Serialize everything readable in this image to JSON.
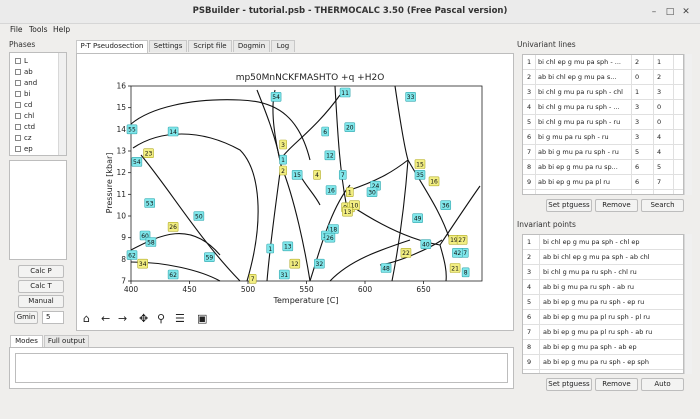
{
  "window": {
    "title": "PSBuilder - tutorial.psb - THERMOCALC 3.50 (Free Pascal version)",
    "minimize": "–",
    "maximize": "□",
    "close": "✕"
  },
  "menu": [
    "File",
    "Tools",
    "Help"
  ],
  "phases_panel": {
    "label": "Phases",
    "items": [
      "L",
      "ab",
      "and",
      "bi",
      "cd",
      "chl",
      "ctd",
      "cz",
      "ep"
    ]
  },
  "left_buttons": {
    "calc_p": "Calc P",
    "calc_t": "Calc T",
    "manual": "Manual",
    "gmin_label": "Gmin",
    "gmin_value": "5"
  },
  "tabs": [
    "P-T Pseudosection",
    "Settings",
    "Script file",
    "Dogmin",
    "Log"
  ],
  "chart_data": {
    "type": "scatter",
    "title": "mp50MnNCKFMASHTO +q +H2O",
    "xlabel": "Temperature [C]",
    "ylabel": "Pressure [kbar]",
    "xlim": [
      400,
      700
    ],
    "ylim": [
      7,
      16
    ],
    "xticks": [
      400,
      450,
      500,
      550,
      600,
      650
    ],
    "yticks": [
      7,
      8,
      9,
      10,
      11,
      12,
      13,
      14,
      15,
      16
    ],
    "univariant_labels": [
      {
        "text": "55",
        "x": 400,
        "y": 14.0
      },
      {
        "text": "54",
        "x": 405,
        "y": 12.5
      },
      {
        "text": "53",
        "x": 416,
        "y": 10.6
      },
      {
        "text": "60",
        "x": 412,
        "y": 9.1
      },
      {
        "text": "58",
        "x": 417,
        "y": 8.8
      },
      {
        "text": "62",
        "x": 400,
        "y": 8.2
      },
      {
        "text": "14",
        "x": 436,
        "y": 13.9
      },
      {
        "text": "50",
        "x": 458,
        "y": 10.0
      },
      {
        "text": "59",
        "x": 467,
        "y": 8.1
      },
      {
        "text": "62",
        "x": 436,
        "y": 7.3
      },
      {
        "text": "54",
        "x": 524,
        "y": 15.5
      },
      {
        "text": "11",
        "x": 583,
        "y": 15.7
      },
      {
        "text": "33",
        "x": 639,
        "y": 15.5
      },
      {
        "text": "20",
        "x": 587,
        "y": 14.1
      },
      {
        "text": "6",
        "x": 566,
        "y": 13.9
      },
      {
        "text": "12",
        "x": 570,
        "y": 12.8
      },
      {
        "text": "1",
        "x": 530,
        "y": 12.6
      },
      {
        "text": "15",
        "x": 542,
        "y": 11.9
      },
      {
        "text": "7",
        "x": 581,
        "y": 11.9
      },
      {
        "text": "16",
        "x": 571,
        "y": 11.2
      },
      {
        "text": "24",
        "x": 609,
        "y": 11.4
      },
      {
        "text": "30",
        "x": 606,
        "y": 11.1
      },
      {
        "text": "35",
        "x": 647,
        "y": 11.9
      },
      {
        "text": "49",
        "x": 645,
        "y": 9.9
      },
      {
        "text": "36",
        "x": 669,
        "y": 10.5
      },
      {
        "text": "13",
        "x": 534,
        "y": 8.6
      },
      {
        "text": "1",
        "x": 519,
        "y": 8.5
      },
      {
        "text": "18",
        "x": 573,
        "y": 9.4
      },
      {
        "text": "17",
        "x": 567,
        "y": 9.1
      },
      {
        "text": "26",
        "x": 570,
        "y": 9.0
      },
      {
        "text": "32",
        "x": 561,
        "y": 7.8
      },
      {
        "text": "31",
        "x": 531,
        "y": 7.3
      },
      {
        "text": "40",
        "x": 652,
        "y": 8.7
      },
      {
        "text": "47",
        "x": 684,
        "y": 8.3
      },
      {
        "text": "42",
        "x": 679,
        "y": 8.3
      },
      {
        "text": "48",
        "x": 618,
        "y": 7.6
      },
      {
        "text": "8",
        "x": 686,
        "y": 7.4
      }
    ],
    "invariant_labels": [
      {
        "text": "23",
        "x": 415,
        "y": 12.9
      },
      {
        "text": "26",
        "x": 436,
        "y": 9.5
      },
      {
        "text": "34",
        "x": 410,
        "y": 7.8
      },
      {
        "text": "3",
        "x": 530,
        "y": 13.3
      },
      {
        "text": "2",
        "x": 530,
        "y": 12.1
      },
      {
        "text": "4",
        "x": 559,
        "y": 11.9
      },
      {
        "text": "1",
        "x": 587,
        "y": 11.1
      },
      {
        "text": "9",
        "x": 583,
        "y": 10.4
      },
      {
        "text": "5",
        "x": 588,
        "y": 10.4
      },
      {
        "text": "10",
        "x": 591,
        "y": 10.5
      },
      {
        "text": "13",
        "x": 585,
        "y": 10.2
      },
      {
        "text": "15",
        "x": 647,
        "y": 12.4
      },
      {
        "text": "16",
        "x": 659,
        "y": 11.6
      },
      {
        "text": "22",
        "x": 635,
        "y": 8.3
      },
      {
        "text": "19",
        "x": 676,
        "y": 8.9
      },
      {
        "text": "27",
        "x": 683,
        "y": 8.9
      },
      {
        "text": "21",
        "x": 677,
        "y": 7.6
      },
      {
        "text": "12",
        "x": 540,
        "y": 7.8
      },
      {
        "text": "7",
        "x": 504,
        "y": 7.1
      }
    ]
  },
  "plot_toolbar": [
    "home-icon",
    "back-icon",
    "forward-icon",
    "pan-icon",
    "zoom-icon",
    "configure-icon",
    "save-icon"
  ],
  "bottom_tabs": [
    "Modes",
    "Full output"
  ],
  "univariant": {
    "label": "Univariant lines",
    "rows": [
      {
        "n": "1",
        "phases": "bi chl ep g mu pa sph - ...",
        "a": "2",
        "b": "1"
      },
      {
        "n": "2",
        "phases": "ab bi chl ep g mu pa s...",
        "a": "0",
        "b": "2"
      },
      {
        "n": "3",
        "phases": "bi chl g mu pa ru sph - chl",
        "a": "1",
        "b": "3"
      },
      {
        "n": "4",
        "phases": "bi chl g mu pa ru sph - ...",
        "a": "3",
        "b": "0"
      },
      {
        "n": "5",
        "phases": "bi chl g mu pa ru sph - ru",
        "a": "3",
        "b": "0"
      },
      {
        "n": "6",
        "phases": "bi g mu pa ru sph - ru",
        "a": "3",
        "b": "4"
      },
      {
        "n": "7",
        "phases": "ab bi g mu pa ru sph - ru",
        "a": "5",
        "b": "4"
      },
      {
        "n": "8",
        "phases": "ab bi ep g mu pa ru sp...",
        "a": "6",
        "b": "5"
      },
      {
        "n": "9",
        "phases": "ab bi ep g mu pa pl ru",
        "a": "6",
        "b": "7"
      }
    ],
    "buttons": [
      "Set ptguess",
      "Remove",
      "Search"
    ]
  },
  "invariant": {
    "label": "Invariant points",
    "rows": [
      {
        "n": "1",
        "phases": "bi chl ep g mu pa sph - chl ep"
      },
      {
        "n": "2",
        "phases": "ab bi chl ep g mu pa sph - ab chl"
      },
      {
        "n": "3",
        "phases": "bi chl g mu pa ru sph - chl ru"
      },
      {
        "n": "4",
        "phases": "ab bi g mu pa ru sph - ab ru"
      },
      {
        "n": "5",
        "phases": "ab bi ep g mu pa ru sph - ep ru"
      },
      {
        "n": "6",
        "phases": "ab bi ep g mu pa pl ru sph - pl ru"
      },
      {
        "n": "7",
        "phases": "ab bi ep g mu pa pl ru sph - ab ru"
      },
      {
        "n": "8",
        "phases": "ab bi ep g mu pa sph - ab ep"
      },
      {
        "n": "9",
        "phases": "ab bi ep g mu pa ru sph - ep sph"
      }
    ],
    "buttons": [
      "Set ptguess",
      "Remove",
      "Auto"
    ]
  }
}
